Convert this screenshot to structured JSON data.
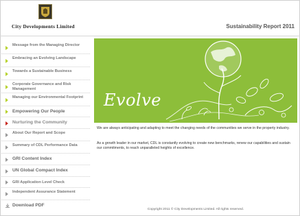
{
  "header": {
    "brand": "City Developments Limited",
    "report_title": "Sustainability Report 2011"
  },
  "sidebar": {
    "items": [
      {
        "label": "Message from the Managing Director"
      },
      {
        "label": "Embracing an Evolving Landscape"
      },
      {
        "label": "Towards a Sustainable Business"
      },
      {
        "label": "Corporate Governance and Risk Management"
      },
      {
        "label": "Managing our Environmental Footprint"
      },
      {
        "label": "Empowering Our People"
      },
      {
        "label": "Nurturing the Community"
      },
      {
        "label": "About Our Report and Scope"
      },
      {
        "label": "Summary of CDL Performance Data"
      },
      {
        "label": "GRI Content Index"
      },
      {
        "label": "UN Global Compact Index"
      },
      {
        "label": "GRI Application Level Check"
      },
      {
        "label": "Independent Assurance Statement"
      },
      {
        "label": "Download PDF"
      }
    ]
  },
  "banner": {
    "script_text": "Evolve"
  },
  "content": {
    "paragraph1": "We are always anticipating and adapting to meet the changing needs of the communities we serve in the property industry.",
    "paragraph2": "As a growth leader in our market, CDL is constantly evolving to create new benchmarks, renew our capabilities and sustain our commitments, to reach unparalleled heights of excellence.",
    "footer": "Copyright 2011 © City Developments Limited. All rights reserved."
  },
  "colors": {
    "banner_green": "#8dbe3a",
    "nav_arrow": "#b7d22e",
    "active_arrow": "#c8281c"
  }
}
